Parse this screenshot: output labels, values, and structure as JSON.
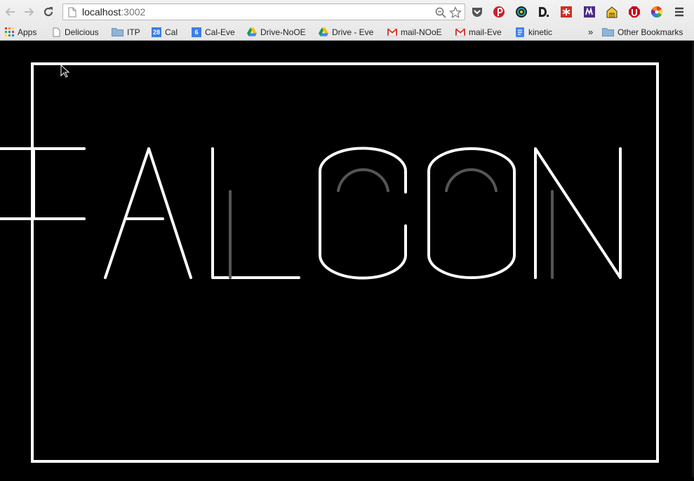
{
  "browser": {
    "url_host": "localhost",
    "url_port": ":3002",
    "extensions": [
      "pocket-icon",
      "pinterest-icon",
      "color-wheel-icon",
      "d-icon",
      "lastpass-icon",
      "m-icon",
      "home-icon",
      "stop-icon",
      "color-picker-icon",
      "menu-icon"
    ],
    "bookmarks": [
      {
        "label": "Apps",
        "icon": "apps-grid-icon"
      },
      {
        "label": "Delicious",
        "icon": "page-icon"
      },
      {
        "label": "ITP",
        "icon": "folder-icon"
      },
      {
        "label": "Cal",
        "icon": "calendar-icon",
        "badge": "28"
      },
      {
        "label": "Cal-Eve",
        "icon": "calendar-icon",
        "badge": "6"
      },
      {
        "label": "Drive-NoOE",
        "icon": "drive-icon"
      },
      {
        "label": "Drive - Eve",
        "icon": "drive-icon"
      },
      {
        "label": "mail-NOoE",
        "icon": "gmail-icon"
      },
      {
        "label": "mail-Eve",
        "icon": "gmail-icon"
      },
      {
        "label": "kinetic",
        "icon": "docs-icon"
      }
    ],
    "overflow": "»",
    "other_bookmarks": "Other Bookmarks"
  },
  "canvas": {
    "background": "#000000",
    "stroke": "#ffffff",
    "ghost_stroke": "#555555",
    "word": "FALCON"
  }
}
